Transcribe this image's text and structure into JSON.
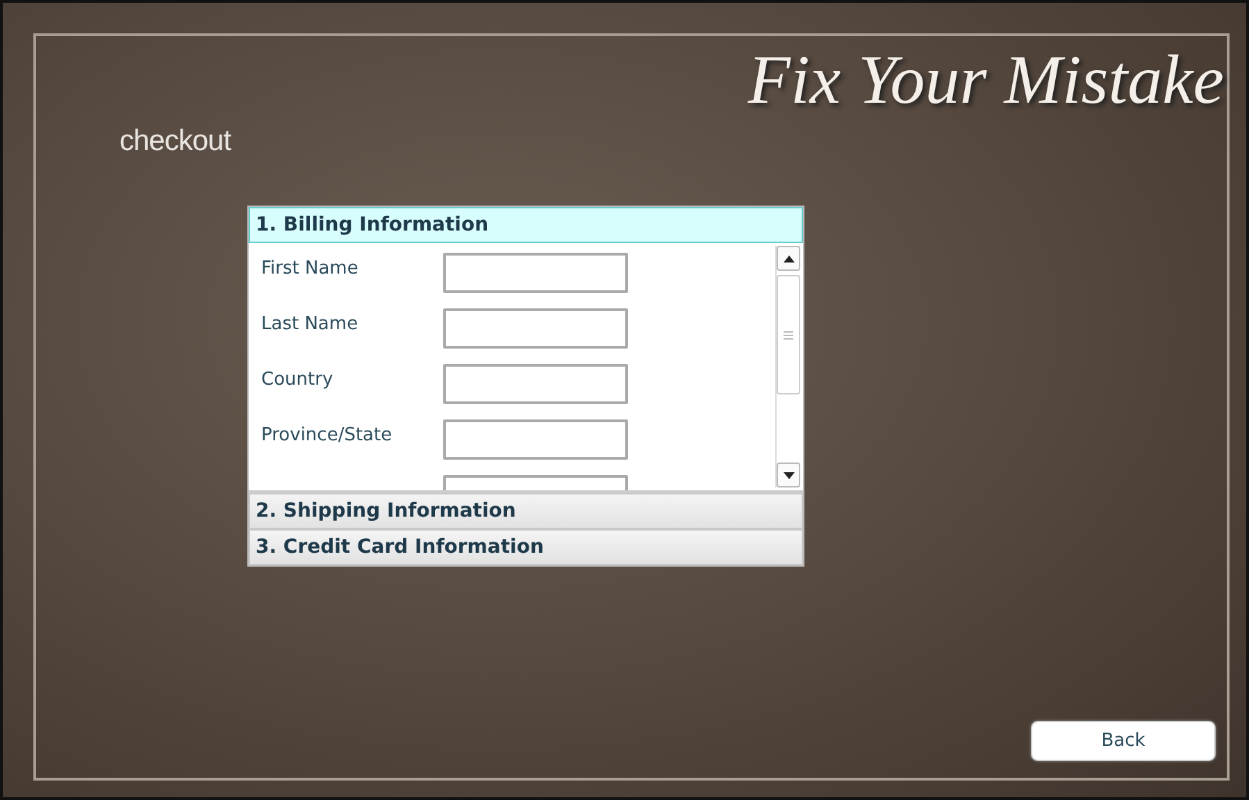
{
  "header": {
    "title": "Fix Your Mistake",
    "subtitle": "checkout"
  },
  "sections": [
    {
      "label": "1. Billing Information",
      "expanded": true
    },
    {
      "label": "2. Shipping Information",
      "expanded": false
    },
    {
      "label": "3. Credit Card Information",
      "expanded": false
    }
  ],
  "fields": [
    {
      "label": "First Name"
    },
    {
      "label": "Last Name"
    },
    {
      "label": "Country"
    },
    {
      "label": "Province/State"
    }
  ],
  "back_button": "Back"
}
